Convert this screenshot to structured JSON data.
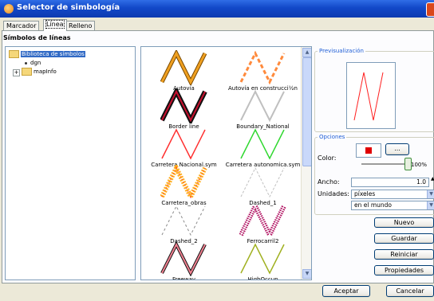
{
  "window": {
    "title": "Selector de simbología"
  },
  "tabs": [
    {
      "label": "Marcador",
      "active": false
    },
    {
      "label": "Línea",
      "active": true
    },
    {
      "label": "Relleno",
      "active": false
    }
  ],
  "section_title": "Símbolos de líneas",
  "tree": {
    "root": "Biblioteca de símbolos",
    "children": [
      "dgn",
      "mapInfo"
    ]
  },
  "symbols": [
    {
      "label": "Autovía",
      "color": "#f0a020",
      "style": "double-orange"
    },
    {
      "label": "Autovía en construcci½n",
      "color": "#ff8a3c",
      "style": "dashed-orange"
    },
    {
      "label": "Border line",
      "color": "#b8182a",
      "style": "black-red"
    },
    {
      "label": "Boundary_National",
      "color": "#bfbfbf",
      "style": "gray"
    },
    {
      "label": "Carretera Nacional.sym",
      "color": "#ff3030",
      "style": "red"
    },
    {
      "label": "Carretera autonomica.sym",
      "color": "#30d830",
      "style": "green"
    },
    {
      "label": "Carretera_obras",
      "color": "#ffb020",
      "style": "dotted-orange"
    },
    {
      "label": "Dashed_1",
      "color": "#c0c0c0",
      "style": "dashed-gray"
    },
    {
      "label": "Dashed_2",
      "color": "#909090",
      "style": "dashed-dark"
    },
    {
      "label": "Ferrocarril2",
      "color": "#b01060",
      "style": "rail"
    },
    {
      "label": "Freeway",
      "color": "#e07080",
      "style": "freeway"
    },
    {
      "label": "HighOccup",
      "color": "#a0b020",
      "style": "olive"
    }
  ],
  "preview": {
    "label": "Previsualización",
    "line_color": "#ff2020"
  },
  "options": {
    "label": "Opciones",
    "color_label": "Color:",
    "color_value": "#e00000",
    "more_button": "...",
    "alpha_text": "100%",
    "alpha": 1.0,
    "width_label": "Ancho:",
    "width_value": "1.0",
    "units_label": "Unidades:",
    "units_value": "píxeles",
    "units_ref": "en el mundo"
  },
  "buttons": {
    "new": "Nuevo",
    "save": "Guardar",
    "reset": "Reiniciar",
    "properties": "Propiedades",
    "accept": "Aceptar",
    "cancel": "Cancelar"
  }
}
